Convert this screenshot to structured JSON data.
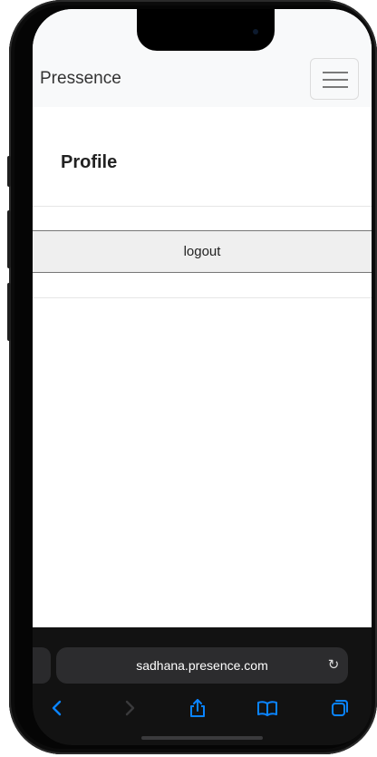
{
  "navbar": {
    "brand": "Pressence",
    "menu_icon": "hamburger-menu-icon"
  },
  "main": {
    "title": "Profile",
    "logout_label": "logout"
  },
  "browser": {
    "url": "sadhana.presence.com",
    "icons": {
      "reload": "reload-icon",
      "back": "back-arrow-icon",
      "forward": "forward-arrow-icon",
      "share": "share-icon",
      "bookmarks": "bookmarks-icon",
      "tabs": "tabs-icon"
    }
  },
  "colors": {
    "navbar_bg": "#f8f9fa",
    "button_bg": "#efefef",
    "safari_accent": "#0a84ff",
    "safari_bg": "#121212"
  }
}
